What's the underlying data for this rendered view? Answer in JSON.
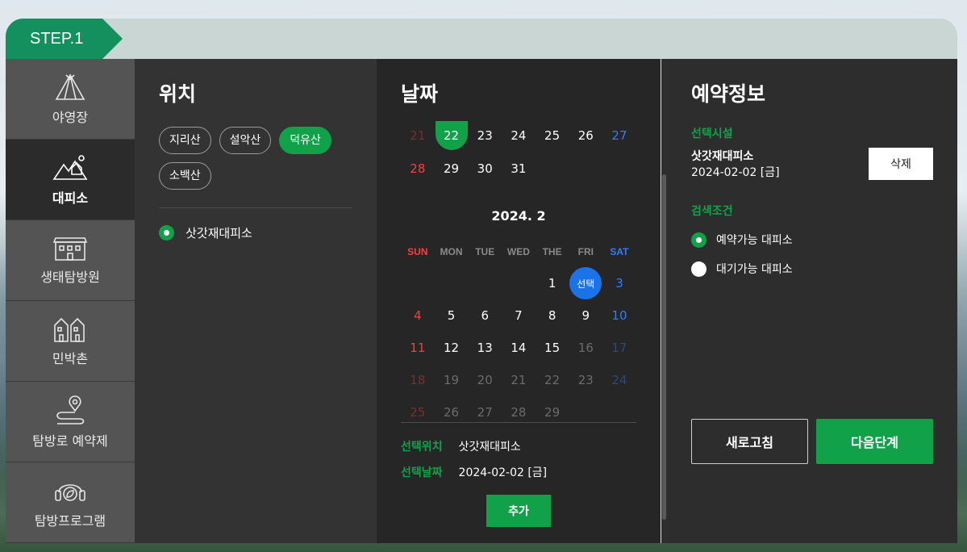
{
  "step_label": "STEP.1",
  "sidebar": {
    "items": [
      {
        "label": "야영장",
        "icon": "tent-icon",
        "active": false
      },
      {
        "label": "대피소",
        "icon": "mountain-shelter-icon",
        "active": true
      },
      {
        "label": "생태탐방원",
        "icon": "building-icon",
        "active": false
      },
      {
        "label": "민박촌",
        "icon": "houses-icon",
        "active": false
      },
      {
        "label": "탐방로 예약제",
        "icon": "trail-pin-icon",
        "active": false
      },
      {
        "label": "탐방프로그램",
        "icon": "headset-leaf-icon",
        "active": false
      }
    ]
  },
  "location": {
    "title": "위치",
    "chips": [
      {
        "label": "지리산",
        "active": false
      },
      {
        "label": "설악산",
        "active": false
      },
      {
        "label": "덕유산",
        "active": true
      },
      {
        "label": "소백산",
        "active": false
      }
    ],
    "shelters": [
      {
        "label": "삿갓재대피소",
        "selected": true
      }
    ]
  },
  "date": {
    "title": "날짜",
    "prev_month_rows": [
      [
        "21",
        "22",
        "23",
        "24",
        "25",
        "26",
        "27"
      ],
      [
        "28",
        "29",
        "30",
        "31",
        "",
        "",
        ""
      ]
    ],
    "month_label": "2024. 2",
    "weekdays": [
      "SUN",
      "MON",
      "TUE",
      "WED",
      "THE",
      "FRI",
      "SAT"
    ],
    "rows": [
      [
        "",
        "",
        "",
        "",
        "1",
        "선택",
        "3"
      ],
      [
        "4",
        "5",
        "6",
        "7",
        "8",
        "9",
        "10"
      ],
      [
        "11",
        "12",
        "13",
        "14",
        "15",
        "16",
        "17"
      ],
      [
        "18",
        "19",
        "20",
        "21",
        "22",
        "23",
        "24"
      ],
      [
        "25",
        "26",
        "27",
        "28",
        "29",
        "",
        ""
      ]
    ],
    "selected_location_label": "선택위치",
    "selected_location_value": "삿갓재대피소",
    "selected_date_label": "선택날짜",
    "selected_date_value": "2024-02-02 [금]",
    "add_label": "추가"
  },
  "reservation": {
    "title": "예약정보",
    "facility_label": "선택시설",
    "facility_name": "삿갓재대피소",
    "facility_date": "2024-02-02 [금]",
    "delete_label": "삭제",
    "search_label": "검색조건",
    "options": [
      {
        "label": "예약가능 대피소",
        "selected": true
      },
      {
        "label": "대기가능 대피소",
        "selected": false
      }
    ],
    "refresh_label": "새로고침",
    "next_label": "다음단계"
  },
  "colors": {
    "accent_green": "#11a149",
    "select_blue": "#1a73e8",
    "sunday_red": "#ff3b3b",
    "saturday_blue": "#2f7cff"
  }
}
